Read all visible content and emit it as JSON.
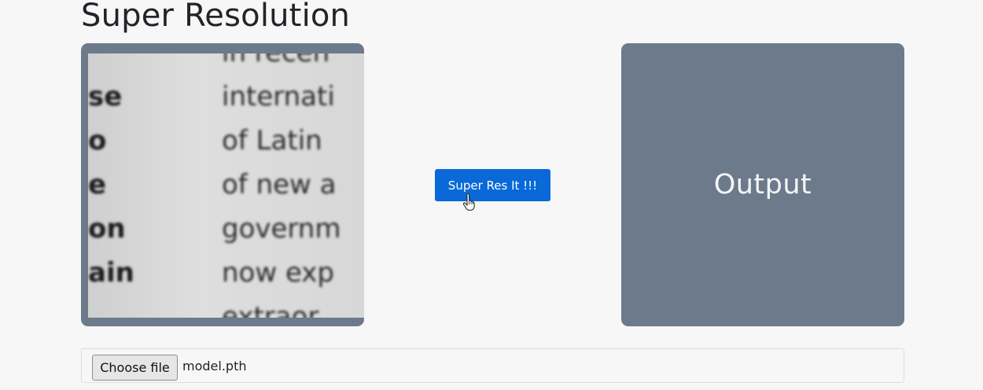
{
  "page": {
    "title": "Super Resolution"
  },
  "input_image": {
    "rows": [
      {
        "left": "",
        "right": "in recen"
      },
      {
        "left": "se",
        "right": "internati"
      },
      {
        "left": "o",
        "right": "of Latin"
      },
      {
        "left": "e",
        "right": "of new a"
      },
      {
        "left": "on",
        "right": "governm"
      },
      {
        "left": "ain",
        "right": "now exp"
      },
      {
        "left": "",
        "right": "extraor"
      }
    ]
  },
  "action": {
    "button_label": "Super Res It !!!"
  },
  "output": {
    "label": "Output"
  },
  "file_input": {
    "button_label": "Choose file",
    "file_name": "model.pth"
  },
  "colors": {
    "primary_button": "#0a69d8",
    "panel_background": "#6c7a8b",
    "page_background": "#f7f7f7"
  }
}
